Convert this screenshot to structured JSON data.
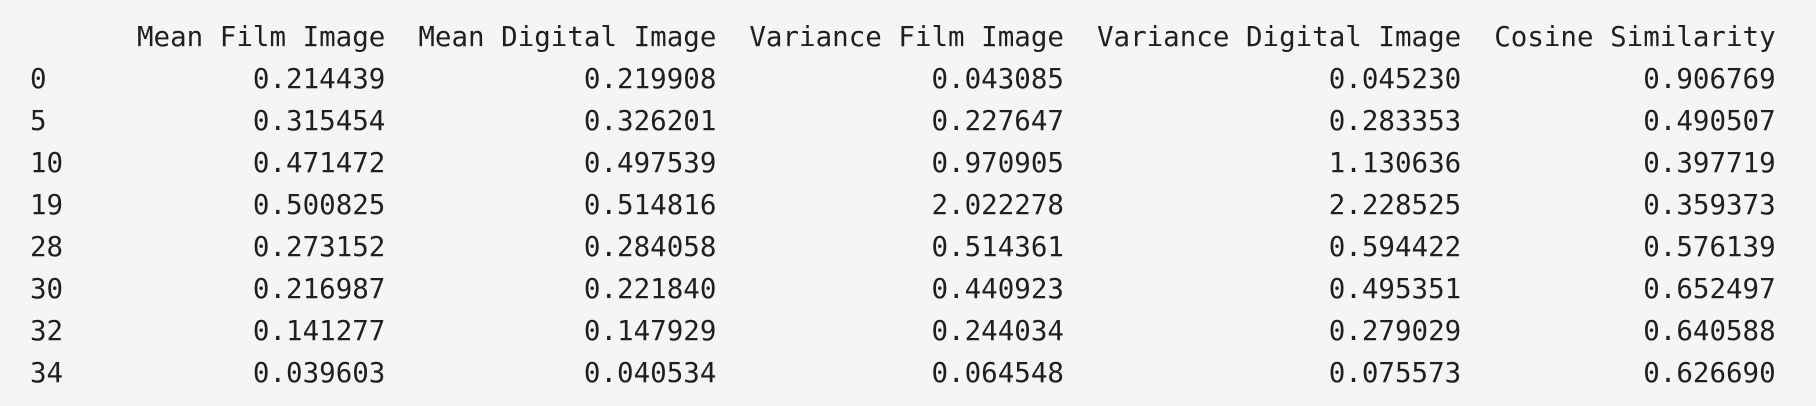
{
  "table": {
    "columns": [
      "Mean Film Image",
      "Mean Digital Image",
      "Variance Film Image",
      "Variance Digital Image",
      "Cosine Similarity"
    ],
    "rows": [
      {
        "index": "0",
        "values": [
          "0.214439",
          "0.219908",
          "0.043085",
          "0.045230",
          "0.906769"
        ]
      },
      {
        "index": "5",
        "values": [
          "0.315454",
          "0.326201",
          "0.227647",
          "0.283353",
          "0.490507"
        ]
      },
      {
        "index": "10",
        "values": [
          "0.471472",
          "0.497539",
          "0.970905",
          "1.130636",
          "0.397719"
        ]
      },
      {
        "index": "19",
        "values": [
          "0.500825",
          "0.514816",
          "2.022278",
          "2.228525",
          "0.359373"
        ]
      },
      {
        "index": "28",
        "values": [
          "0.273152",
          "0.284058",
          "0.514361",
          "0.594422",
          "0.576139"
        ]
      },
      {
        "index": "30",
        "values": [
          "0.216987",
          "0.221840",
          "0.440923",
          "0.495351",
          "0.652497"
        ]
      },
      {
        "index": "32",
        "values": [
          "0.141277",
          "0.147929",
          "0.244034",
          "0.279029",
          "0.640588"
        ]
      },
      {
        "index": "34",
        "values": [
          "0.039603",
          "0.040534",
          "0.064548",
          "0.075573",
          "0.626690"
        ]
      }
    ]
  }
}
